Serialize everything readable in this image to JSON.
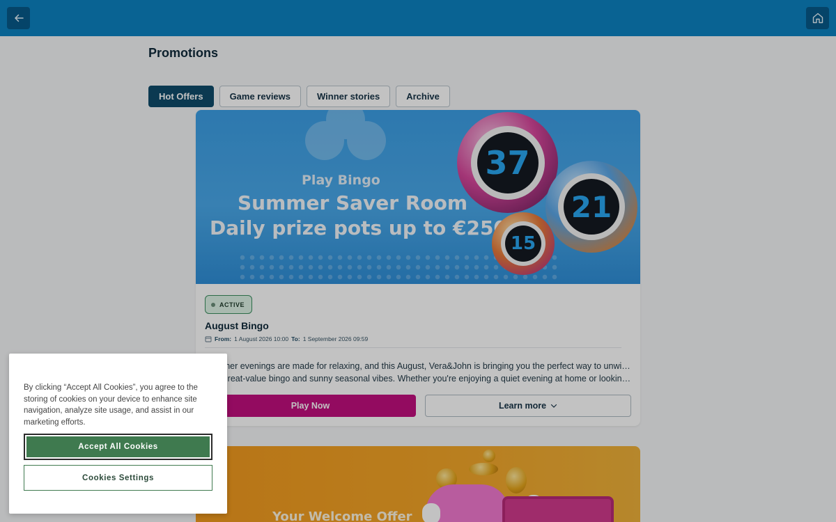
{
  "header": {
    "back_icon": "arrow-left-icon",
    "home_icon": "home-icon",
    "bar_color": "#0d83c1"
  },
  "page": {
    "title": "Promotions"
  },
  "tabs": [
    {
      "label": "Hot Offers",
      "active": true
    },
    {
      "label": "Game reviews",
      "active": false
    },
    {
      "label": "Winner stories",
      "active": false
    },
    {
      "label": "Archive",
      "active": false
    }
  ],
  "promo_card": {
    "banner": {
      "line1": "Play Bingo",
      "line2": "Summer Saver Room",
      "line3": "Daily prize pots up to €250!",
      "balls": [
        "37",
        "21",
        "15"
      ]
    },
    "status": "ACTIVE",
    "title": "August Bingo",
    "dates": {
      "from_label": "From:",
      "from_value": "1 August 2026 10:00",
      "to_label": "To:",
      "to_value": "1 September 2026 09:59"
    },
    "description_line1": "Summer evenings are made for relaxing, and this August, Vera&John is bringing you the perfect way to unwind",
    "description_line2": "with great-value bingo and sunny seasonal vibes. Whether you're enjoying a quiet evening at home or looking for…",
    "play_label": "Play Now",
    "learn_label": "Learn more",
    "play_color": "#c20f7f"
  },
  "promo_card_2": {
    "banner_title": "Your Welcome Offer"
  },
  "cookie_banner": {
    "text": "By clicking “Accept All Cookies”, you agree to the storing of cookies on your device to enhance site navigation, analyze site usage, and assist in our marketing efforts.",
    "accept_label": "Accept All Cookies",
    "settings_label": "Cookies Settings",
    "accent_color": "#3f7a4f"
  }
}
